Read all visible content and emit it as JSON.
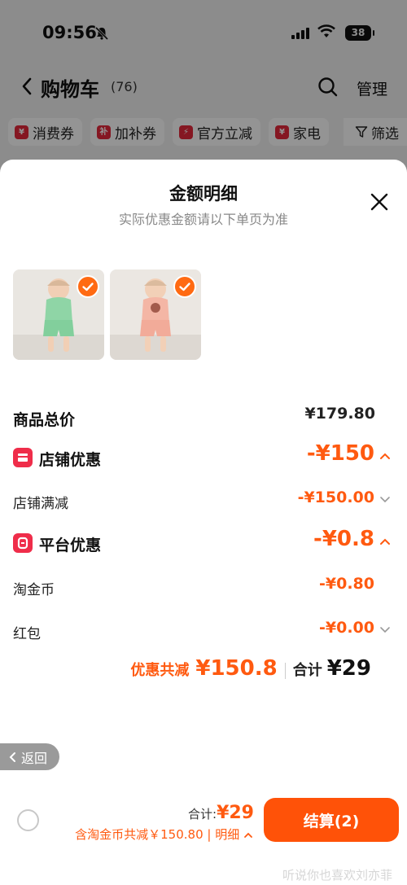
{
  "status": {
    "time": "09:56",
    "battery": "38"
  },
  "header": {
    "title": "购物车",
    "count": "(76)",
    "manage_label": "管理"
  },
  "filters": [
    {
      "icon": "¥",
      "label": "消费券"
    },
    {
      "icon": "补",
      "label": "加补券"
    },
    {
      "icon": "⚡",
      "label": "官方立减"
    },
    {
      "icon": "¥",
      "label": "家电"
    }
  ],
  "filter_button": "筛选",
  "sheet": {
    "title": "金额明细",
    "subtitle": "实际优惠金额请以下单页为准",
    "rows": {
      "goods_total": {
        "label": "商品总价",
        "value": "¥179.80"
      },
      "store_discount": {
        "label": "店铺优惠",
        "value": "-¥150"
      },
      "store_full_reduce": {
        "label": "店铺满减",
        "value": "-¥150.00"
      },
      "platform_discount": {
        "label": "平台优惠",
        "value": "-¥0.8"
      },
      "taojinbi": {
        "label": "淘金币",
        "value": "-¥0.80"
      },
      "red_packet": {
        "label": "红包",
        "value": "-¥0.00"
      }
    },
    "summary": {
      "discount_label": "优惠共减",
      "discount_value": "¥150.8",
      "total_label": "合计",
      "total_value": "¥29"
    },
    "back_label": "返回"
  },
  "bottom_bar": {
    "total_label": "合计:",
    "total_value": "¥29",
    "savings_text": "含淘金币共减￥150.80 | 明细",
    "checkout_label": "结算(2)",
    "watermark": "听说你也喜欢刘亦菲"
  },
  "colors": {
    "accent": "#ff5a10",
    "checkout": "#ff5208",
    "red_icon": "#ef2d4a"
  }
}
